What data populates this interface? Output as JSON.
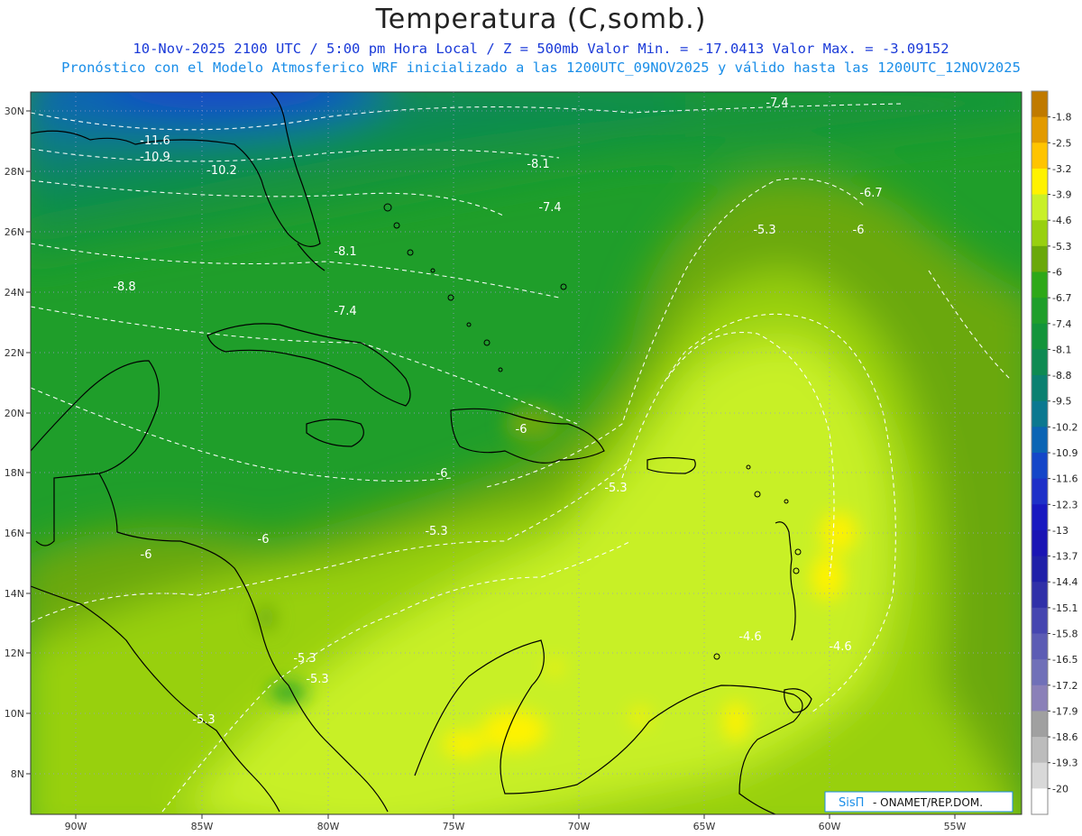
{
  "header": {
    "title": "Temperatura (C,somb.)",
    "line1": "10-Nov-2025  2100 UTC / 5:00 pm Hora Local / Z = 500mb  Valor Min. = -17.0413  Valor Max. = -3.09152",
    "line2": "Pronóstico con el Modelo Atmosferico WRF inicializado a las 1200UTC_09NOV2025 y válido hasta las  1200UTC_12NOV2025"
  },
  "axes": {
    "lon_labels": [
      "90W",
      "85W",
      "80W",
      "75W",
      "70W",
      "65W",
      "60W",
      "55W"
    ],
    "lat_labels": [
      "30N",
      "28N",
      "26N",
      "24N",
      "22N",
      "20N",
      "18N",
      "16N",
      "14N",
      "12N",
      "10N",
      "8N"
    ]
  },
  "colorbar": {
    "labels": [
      "-1.8",
      "-2.5",
      "-3.2",
      "-3.9",
      "-4.6",
      "-5.3",
      "-6",
      "-6.7",
      "-7.4",
      "-8.1",
      "-8.8",
      "-9.5",
      "-10.2",
      "-10.9",
      "-11.6",
      "-12.3",
      "-13",
      "-13.7",
      "-14.4",
      "-15.1",
      "-15.8",
      "-16.5",
      "-17.2",
      "-17.9",
      "-18.6",
      "-19.3",
      "-20"
    ],
    "colors": [
      "#c07a00",
      "#e29a00",
      "#ffc400",
      "#fff200",
      "#c8f028",
      "#98d010",
      "#6aa80a",
      "#2ea818",
      "#1f9e2a",
      "#13943a",
      "#0e8a52",
      "#0b8070",
      "#0b7890",
      "#0b64b4",
      "#1446c8",
      "#1e30c8",
      "#1818c0",
      "#1a14b4",
      "#2020a8",
      "#3030a8",
      "#4646b0",
      "#5c5cb4",
      "#7070b8",
      "#8a80b8",
      "#a0a0a0",
      "#bcbcbc",
      "#d8d8d8",
      "#ffffff"
    ]
  },
  "contour_labels": [
    {
      "text": "-7.4"
    },
    {
      "text": "-11.6"
    },
    {
      "text": "-10.9"
    },
    {
      "text": "-10.2"
    },
    {
      "text": "-8.1"
    },
    {
      "text": "-6.7"
    },
    {
      "text": "-7.4"
    },
    {
      "text": "-5.3"
    },
    {
      "text": "-6"
    },
    {
      "text": "-8.1"
    },
    {
      "text": "-8.8"
    },
    {
      "text": "-7.4"
    },
    {
      "text": "-6"
    },
    {
      "text": "-6"
    },
    {
      "text": "-5.3"
    },
    {
      "text": "-5.3"
    },
    {
      "text": "-6"
    },
    {
      "text": "-6"
    },
    {
      "text": "-4.6"
    },
    {
      "text": "-4.6"
    },
    {
      "text": "-5.3"
    },
    {
      "text": "-5.3"
    },
    {
      "text": "-5.3"
    }
  ],
  "credit": {
    "logo": "SisΠ",
    "text": " - ONAMET/REP.DOM."
  }
}
